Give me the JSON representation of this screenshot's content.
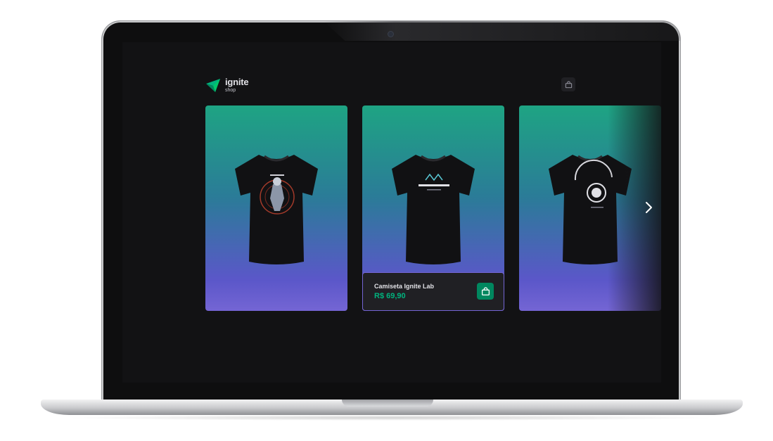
{
  "app": {
    "logo": {
      "title": "ignite",
      "subtitle": "shop",
      "icon": "ignite-logo-icon",
      "color": "#00b37e"
    },
    "header": {
      "cart_icon": "shopping-bag-icon"
    }
  },
  "carousel": {
    "products": [
      {
        "design": "astronaut"
      },
      {
        "design": "ignite-lab",
        "name": "Camiseta Ignite Lab",
        "price": "R$ 69,90",
        "add_icon": "shopping-bag-icon"
      },
      {
        "design": "igniter-abord"
      }
    ],
    "next_icon": "chevron-right-icon"
  },
  "colors": {
    "background": "#121214",
    "card_top": "#1ea483",
    "card_bottom": "#7465d4",
    "price": "#00b37e",
    "cart_button": "#00875f"
  }
}
